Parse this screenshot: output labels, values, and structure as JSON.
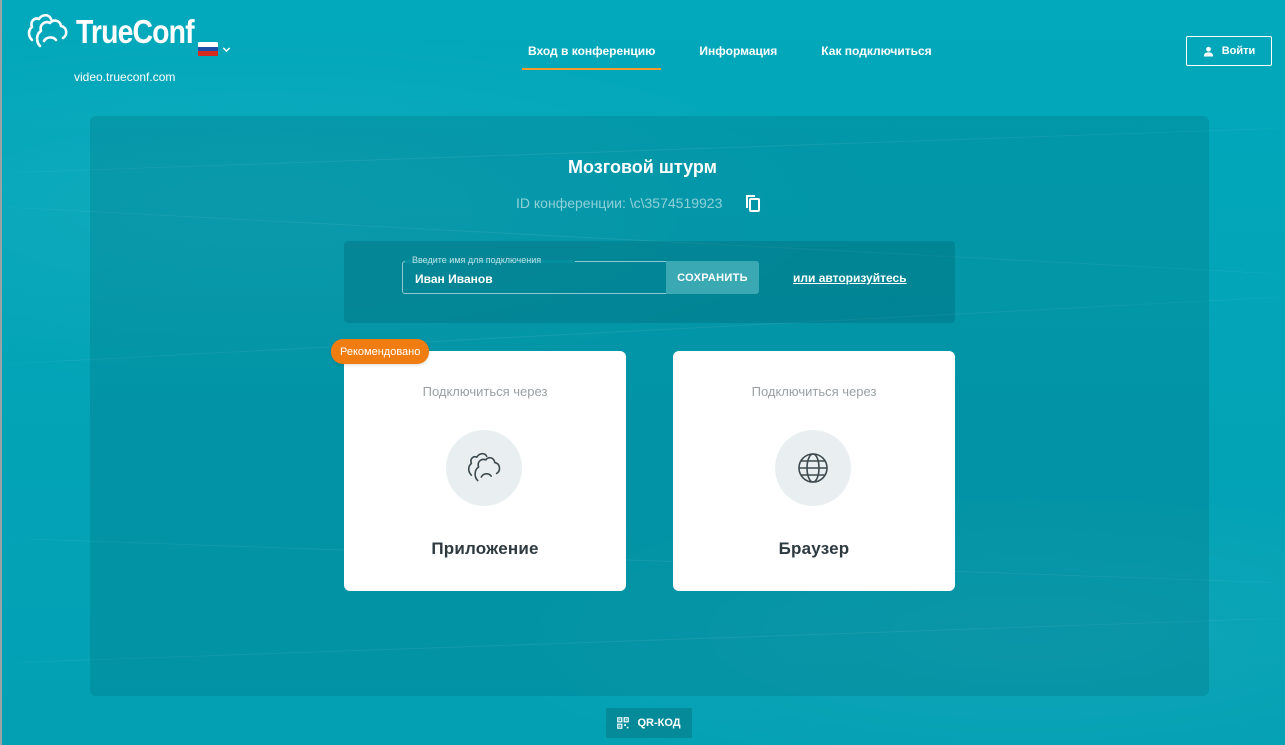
{
  "header": {
    "logo_text": "TrueConf",
    "domain": "video.trueconf.com",
    "nav": [
      {
        "label": "Вход в конференцию",
        "active": true
      },
      {
        "label": "Информация",
        "active": false
      },
      {
        "label": "Как подключиться",
        "active": false
      }
    ],
    "login_label": "Войти",
    "language_flag": [
      "#ffffff",
      "#1f4ea8",
      "#d52b1e"
    ],
    "language_icon": "chevron-down-icon"
  },
  "conference": {
    "title": "Мозговой штурм",
    "id_text": "ID конференции: \\c\\3574519923"
  },
  "name_form": {
    "legend": "Введите имя для подключения",
    "value": "Иван Иванов",
    "save_label": "СОХРАНИТЬ",
    "auth_link": "или авторизуйтесь"
  },
  "cards": {
    "badge": "Рекомендовано",
    "app": {
      "subtitle": "Подключиться через",
      "title": "Приложение",
      "icon": "people-icon"
    },
    "browser": {
      "subtitle": "Подключиться через",
      "title": "Браузер",
      "icon": "globe-icon"
    }
  },
  "footer": {
    "qr_label": "QR-КОД",
    "qr_icon": "qr-code-icon"
  },
  "colors": {
    "background": "#03a5b8",
    "accent": "#f39a2a",
    "badge": "#ef7d12",
    "card": "#ffffff"
  }
}
